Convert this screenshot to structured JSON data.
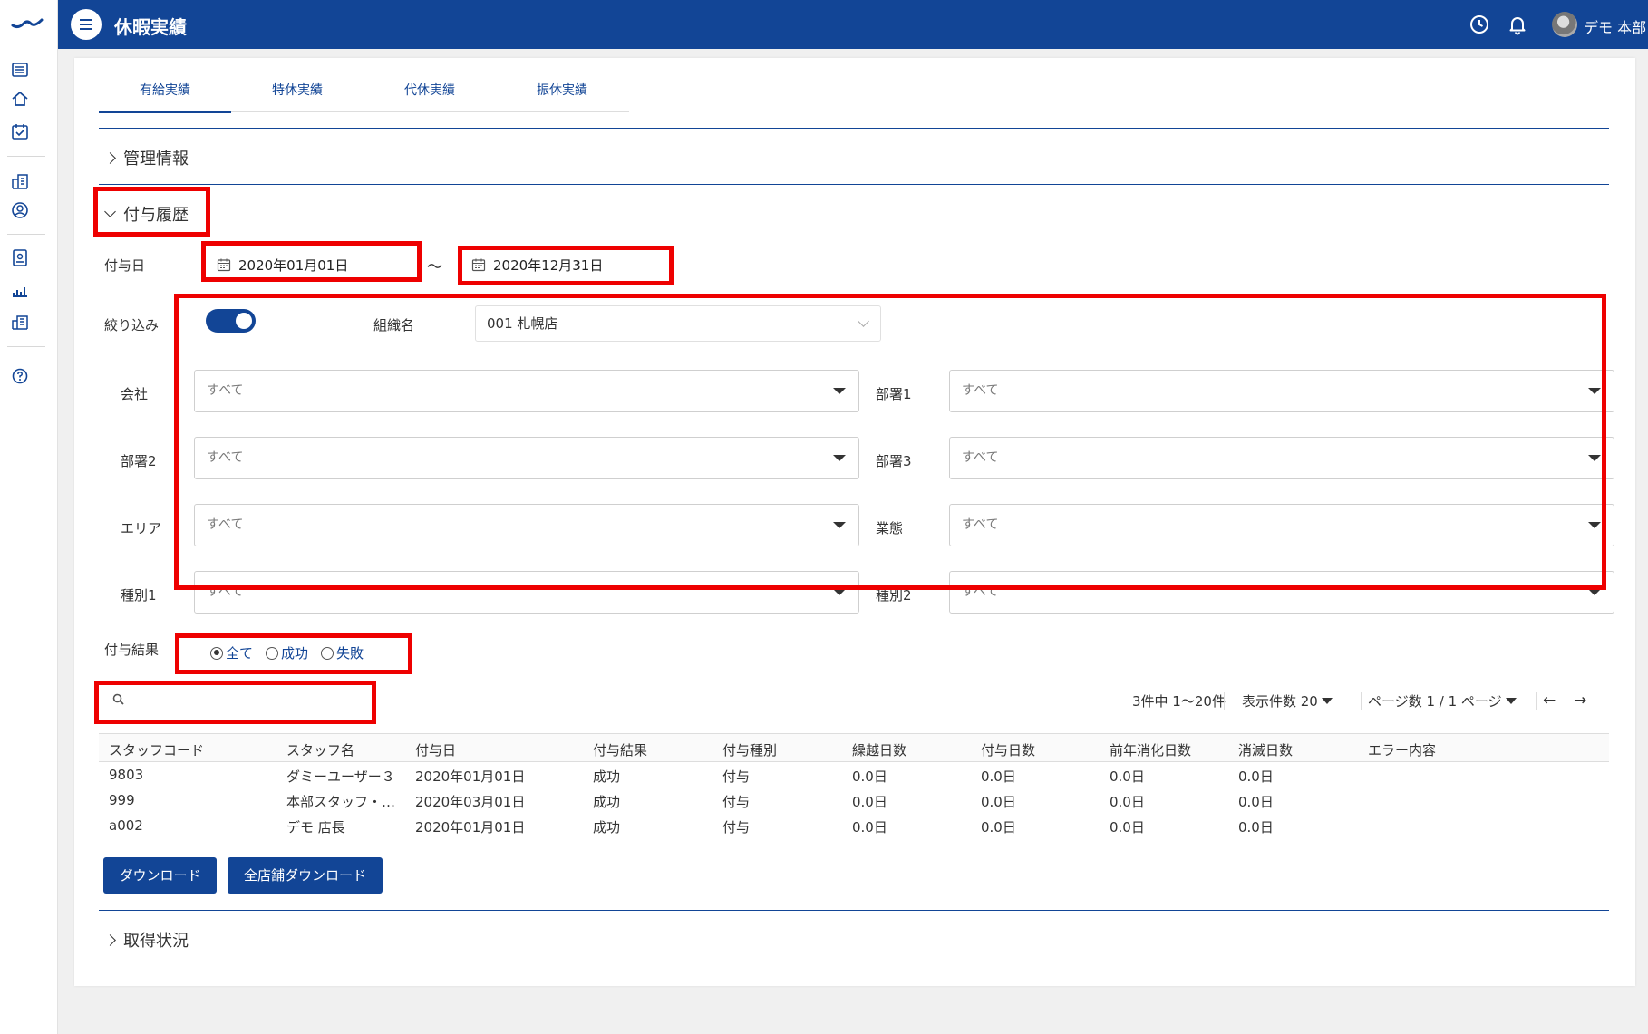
{
  "header": {
    "title": "休暇実績",
    "user_name": "デモ 本部"
  },
  "tabs": [
    {
      "label": "有給実績",
      "active": true
    },
    {
      "label": "特休実績",
      "active": false
    },
    {
      "label": "代休実績",
      "active": false
    },
    {
      "label": "振休実績",
      "active": false
    }
  ],
  "sections": {
    "management": "管理情報",
    "grant_history": "付与履歴",
    "acquisition": "取得状況"
  },
  "filters": {
    "grant_date_label": "付与日",
    "date_from": "2020年01月01日",
    "date_separator": "〜",
    "date_to": "2020年12月31日",
    "narrow_label": "絞り込み",
    "narrow_on": true,
    "org_label": "組織名",
    "org_value": "001 札幌店",
    "fields": [
      {
        "label": "会社",
        "value": "すべて"
      },
      {
        "label": "部署1",
        "value": "すべて"
      },
      {
        "label": "部署2",
        "value": "すべて"
      },
      {
        "label": "部署3",
        "value": "すべて"
      },
      {
        "label": "エリア",
        "value": "すべて"
      },
      {
        "label": "業態",
        "value": "すべて"
      },
      {
        "label": "種別1",
        "value": "すべて"
      },
      {
        "label": "種別2",
        "value": "すべて"
      }
    ],
    "result_label": "付与結果",
    "result_options": [
      {
        "label": "全て",
        "selected": true
      },
      {
        "label": "成功",
        "selected": false
      },
      {
        "label": "失敗",
        "selected": false
      }
    ]
  },
  "search": {
    "value": ""
  },
  "pager": {
    "summary": "3件中 1〜20件",
    "per_page": "表示件数 20",
    "page_info": "ページ数 1 / 1 ページ",
    "prev": "←",
    "next": "→"
  },
  "table": {
    "columns": [
      "スタッフコード",
      "スタッフ名",
      "付与日",
      "付与結果",
      "付与種別",
      "繰越日数",
      "付与日数",
      "前年消化日数",
      "消滅日数",
      "エラー内容"
    ],
    "rows": [
      [
        "9803",
        "ダミーユーザー３",
        "2020年01月01日",
        "成功",
        "付与",
        "0.0日",
        "0.0日",
        "0.0日",
        "0.0日",
        ""
      ],
      [
        "999",
        "本部スタッフ・…",
        "2020年03月01日",
        "成功",
        "付与",
        "0.0日",
        "0.0日",
        "0.0日",
        "0.0日",
        ""
      ],
      [
        "a002",
        "デモ 店長",
        "2020年01月01日",
        "成功",
        "付与",
        "0.0日",
        "0.0日",
        "0.0日",
        "0.0日",
        ""
      ]
    ]
  },
  "buttons": {
    "download": "ダウンロード",
    "download_all": "全店舗ダウンロード"
  },
  "colors": {
    "primary": "#124596",
    "highlight": "#ee0000"
  }
}
